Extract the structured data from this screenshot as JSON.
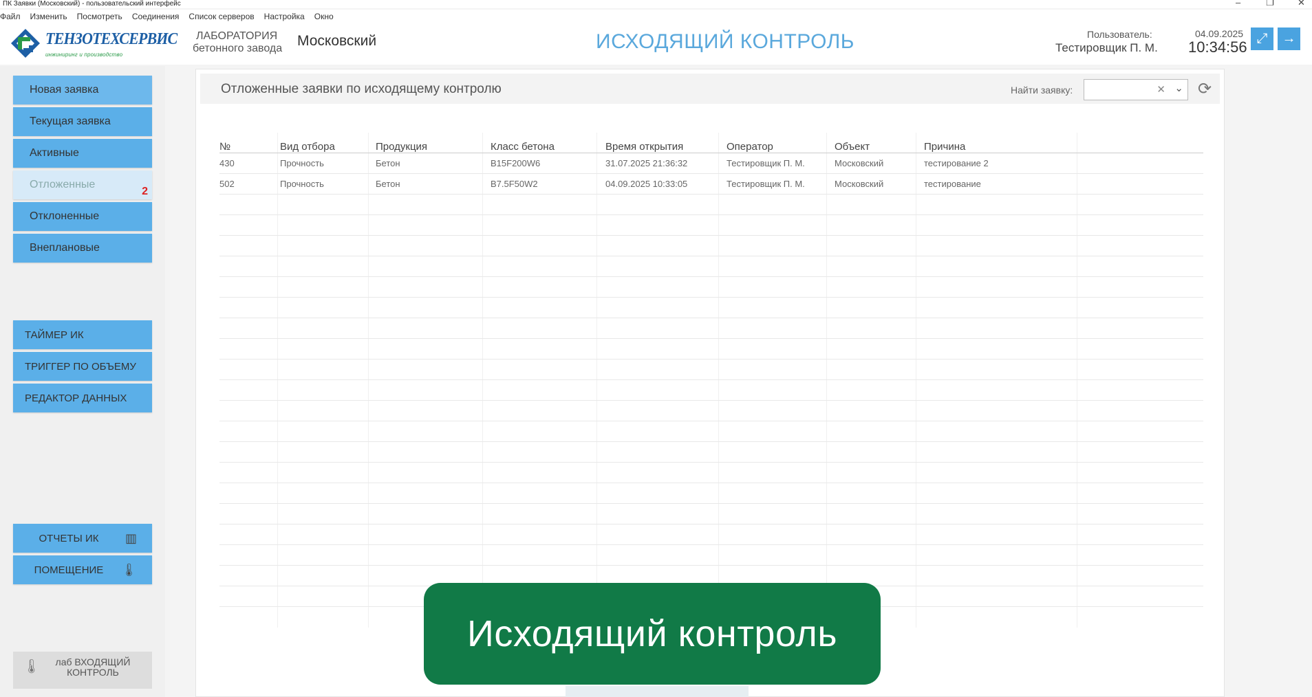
{
  "window": {
    "title": "ПК Заявки (Московский) - пользовательский интерфейс"
  },
  "menu": [
    "Файл",
    "Изменить",
    "Посмотреть",
    "Соединения",
    "Список серверов",
    "Настройка",
    "Окно"
  ],
  "header": {
    "logo_text": "ТЕНЗОТЕХСЕРВИС",
    "logo_sub": "инжиниринг и производство",
    "lab_line1": "ЛАБОРАТОРИЯ",
    "lab_line2": "бетонного завода",
    "location": "Московский",
    "page_title": "ИСХОДЯЩИЙ КОНТРОЛЬ",
    "user_label": "Пользователь:",
    "user_name": "Тестировщик П. М.",
    "date": "04.09.2025",
    "time": "10:34:56"
  },
  "sidebar": {
    "items": [
      {
        "label": "Новая заявка"
      },
      {
        "label": "Текущая заявка"
      },
      {
        "label": "Активные"
      },
      {
        "label": "Отложенные",
        "badge": "2"
      },
      {
        "label": "Отклоненные"
      },
      {
        "label": "Внеплановые"
      }
    ],
    "tools": [
      {
        "label": "ТАЙМЕР ИК"
      },
      {
        "label": "ТРИГГЕР ПО ОБЪЕМУ"
      },
      {
        "label": "РЕДАКТОР ДАННЫХ"
      }
    ],
    "bottom": [
      {
        "label": "ОТЧЕТЫ ИК"
      },
      {
        "label": "ПОМЕЩЕНИЕ"
      }
    ],
    "lab_in_line1": "лаб ВХОДЯЩИЙ",
    "lab_in_line2": "КОНТРОЛЬ"
  },
  "panel": {
    "title": "Отложенные заявки по исходящему контролю",
    "find_label": "Найти заявку:",
    "find_value": ""
  },
  "table": {
    "headers": [
      "№",
      "Вид отбора",
      "Продукция",
      "Класс бетона",
      "Время открытия",
      "Оператор",
      "Объект",
      "Причина"
    ],
    "rows": [
      [
        "430",
        "Прочность",
        "Бетон",
        "B15F200W6",
        "31.07.2025 21:36:32",
        "Тестировщик П. М.",
        "Московский",
        "тестирование 2"
      ],
      [
        "502",
        "Прочность",
        "Бетон",
        "B7.5F50W2",
        "04.09.2025 10:33:05",
        "Тестировщик П. М.",
        "Московский",
        "тестирование"
      ]
    ]
  },
  "caption": "Исходящий контроль",
  "colors": {
    "accent": "#5bafe8",
    "title": "#5aa8dc",
    "caption_bg": "#117a47",
    "badge": "#d22222"
  }
}
